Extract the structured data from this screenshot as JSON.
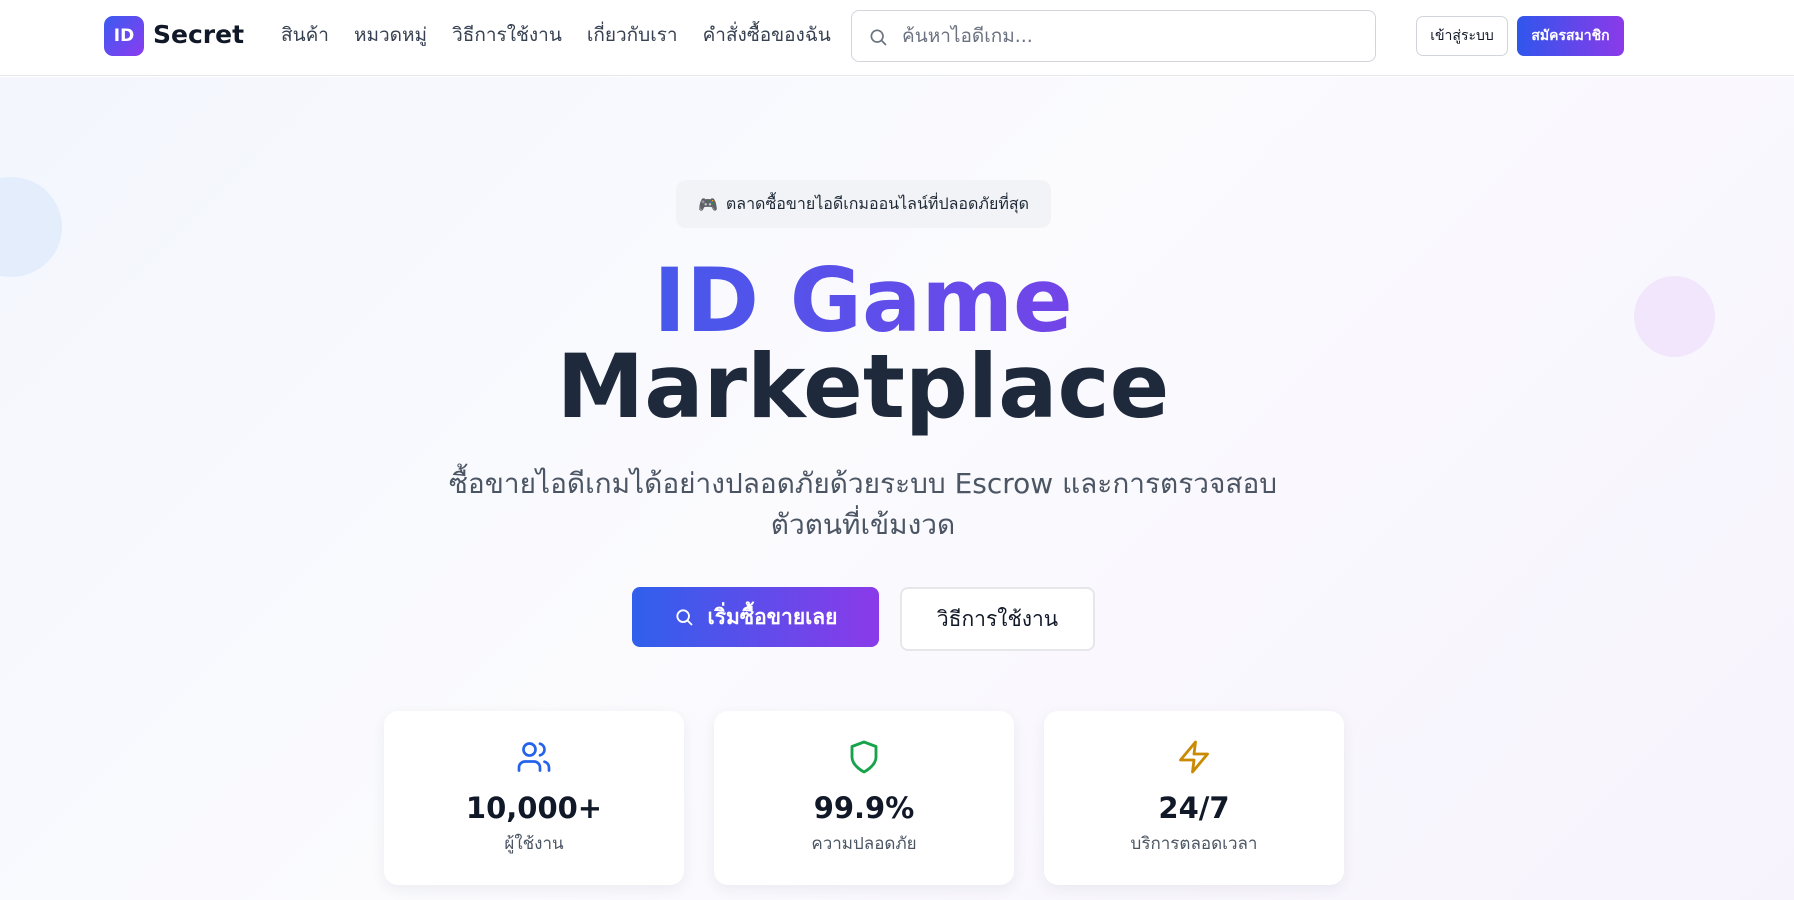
{
  "brand": {
    "logo_letters": "ID",
    "name": "Secret"
  },
  "nav": {
    "links": [
      "สินค้า",
      "หมวดหมู่",
      "วิธีการใช้งาน",
      "เกี่ยวกับเรา",
      "คำสั่งซื้อของฉัน"
    ]
  },
  "search": {
    "placeholder": "ค้นหาไอดีเกม..."
  },
  "auth": {
    "login_label": "เข้าสู่ระบบ",
    "signup_label": "สมัครสมาชิก"
  },
  "hero": {
    "badge_emoji": "🎮",
    "badge_text": "ตลาดซื้อขายไอดีเกมออนไลน์ที่ปลอดภัยที่สุด",
    "title_line1": "ID Game",
    "title_line2": "Marketplace",
    "subtitle": "ซื้อขายไอดีเกมได้อย่างปลอดภัยด้วยระบบ Escrow และการตรวจสอบตัวตนที่เข้มงวด",
    "cta_primary": "เริ่มซื้อขายเลย",
    "cta_secondary": "วิธีการใช้งาน"
  },
  "stats": [
    {
      "icon": "users-icon",
      "value": "10,000+",
      "label": "ผู้ใช้งาน",
      "color": "#2563eb"
    },
    {
      "icon": "shield-icon",
      "value": "99.9%",
      "label": "ความปลอดภัย",
      "color": "#16a34a"
    },
    {
      "icon": "lightning-icon",
      "value": "24/7",
      "label": "บริการตลอดเวลา",
      "color": "#ca8a04"
    }
  ],
  "colors": {
    "brand_blue": "#2f63ea",
    "brand_purple": "#8b3ae9",
    "title_dark": "#1e293b"
  }
}
